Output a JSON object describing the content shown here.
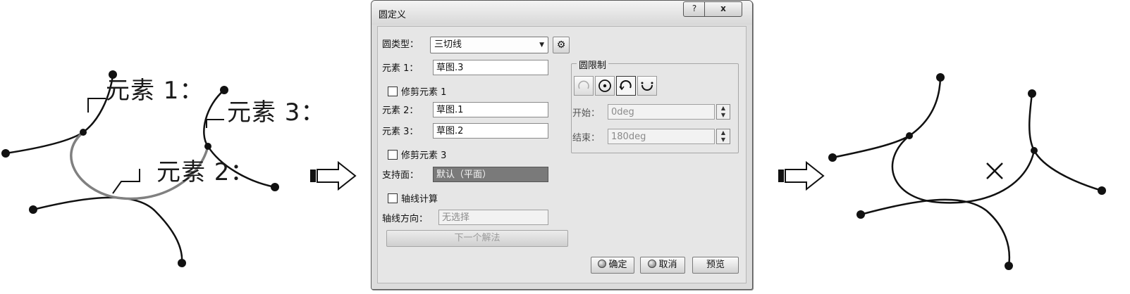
{
  "canvas_left": {
    "label_element1": "元素 1：",
    "label_element3": "元素 3：",
    "label_element2": "元素 2："
  },
  "dialog": {
    "title": "圆定义",
    "help_button": "?",
    "close_button": "x",
    "circle_type_label": "圆类型：",
    "circle_type_value": "三切线",
    "element1_label": "元素 1：",
    "element1_value": "草图.3",
    "trim_element1_label": "修剪元素 1",
    "element2_label": "元素 2：",
    "element2_value": "草图.1",
    "element3_label": "元素 3：",
    "element3_value": "草图.2",
    "trim_element3_label": "修剪元素 3",
    "support_label": "支持面：",
    "support_value": "默认（平面）",
    "axis_compute_label": "轴线计算",
    "axis_direction_label": "轴线方向：",
    "axis_direction_value": "无选择",
    "next_solution_label": "下一个解法",
    "circle_limits": {
      "title": "圆限制",
      "start_label": "开始：",
      "start_value": "0deg",
      "end_label": "结束：",
      "end_value": "180deg"
    },
    "ok_label": "确定",
    "cancel_label": "取消",
    "preview_label": "预览"
  },
  "colors": {
    "dialog_bg": "#dcdcdc",
    "curve": "#111111",
    "result_arc": "#7a7a7a",
    "support_field": "#7a7a7a"
  },
  "icons": [
    "arrow-right-icon",
    "combo-dropdown-icon",
    "sketch-tool-icon",
    "limit-partial-icon",
    "limit-full-circle-icon",
    "limit-trim-icon",
    "limit-complement-icon",
    "spinner-icon",
    "ok-dot-icon",
    "cancel-dot-icon"
  ]
}
